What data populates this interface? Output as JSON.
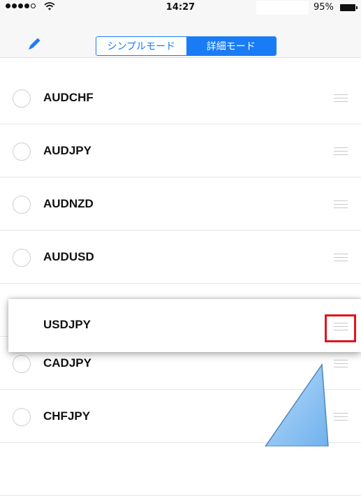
{
  "status_bar": {
    "wifi_icon": "wifi-icon",
    "time": "14:27",
    "battery_pct": "95%"
  },
  "nav": {
    "edit_icon": "pencil-icon",
    "segments": [
      {
        "label": "シンプルモード",
        "active": false
      },
      {
        "label": "詳細モード",
        "active": true
      }
    ]
  },
  "rows": [
    {
      "label": "AUDCHF"
    },
    {
      "label": "AUDJPY"
    },
    {
      "label": "AUDNZD"
    },
    {
      "label": "AUDUSD"
    },
    {
      "label": ""
    },
    {
      "label": "CADJPY"
    },
    {
      "label": "CHFJPY"
    },
    {
      "label": ""
    }
  ],
  "dragged_row": {
    "label": "USDJPY"
  },
  "colors": {
    "accent": "#1a7cf5",
    "highlight": "#e1141c",
    "callout": "#8cc3f2"
  }
}
